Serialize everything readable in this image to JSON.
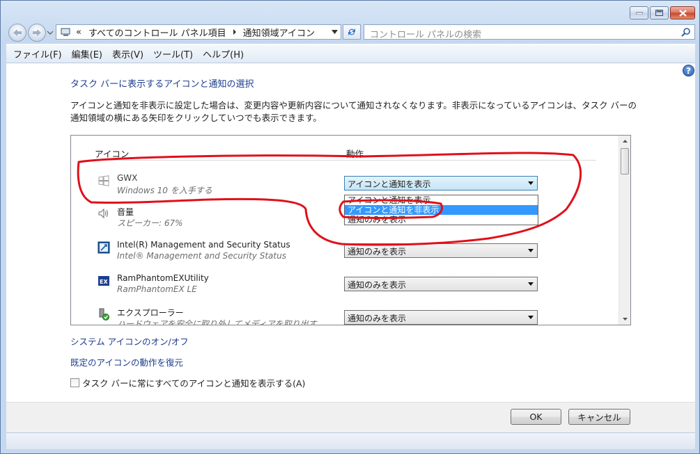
{
  "window": {
    "address_prefix": "«",
    "breadcrumb": [
      "すべてのコントロール パネル項目",
      "通知領域アイコン"
    ],
    "search_placeholder": "コントロール パネルの検索"
  },
  "menubar": {
    "items": [
      "ファイル(F)",
      "編集(E)",
      "表示(V)",
      "ツール(T)",
      "ヘルプ(H)"
    ]
  },
  "main": {
    "heading": "タスク バーに表示するアイコンと通知の選択",
    "description": "アイコンと通知を非表示に設定した場合は、変更内容や更新内容について通知されなくなります。非表示になっているアイコンは、タスク バーの通知領域の横にある矢印をクリックしていつでも表示できます。",
    "columns": {
      "icon": "アイコン",
      "behavior": "動作"
    },
    "rows": [
      {
        "name": "GWX",
        "sub": "Windows 10 を入手する",
        "behavior": "アイコンと通知を表示",
        "icon": "windows-logo-icon"
      },
      {
        "name": "音量",
        "sub": "スピーカー: 67%",
        "behavior": "アイコンと通知を表示",
        "icon": "speaker-icon"
      },
      {
        "name": "Intel(R) Management and Security Status",
        "sub": "Intel® Management and Security Status",
        "behavior": "通知のみを表示",
        "icon": "intel-security-icon"
      },
      {
        "name": "RamPhantomEXUtility",
        "sub": "RamPhantomEX LE",
        "behavior": "通知のみを表示",
        "icon": "ramphantom-icon"
      },
      {
        "name": "エクスプローラー",
        "sub": "ハードウェアを安全に取り外してメディアを取り出す",
        "behavior": "通知のみを表示",
        "icon": "safely-remove-icon"
      }
    ],
    "dropdown_options": [
      "アイコンと通知を表示",
      "アイコンと通知を非表示",
      "通知のみを表示"
    ],
    "dropdown_selected_index": 1
  },
  "links": {
    "system_icons": "システム アイコンのオン/オフ",
    "restore_defaults": "既定のアイコンの動作を復元"
  },
  "checkbox": {
    "always_show": "タスク バーに常にすべてのアイコンと通知を表示する(A)",
    "checked": false
  },
  "buttons": {
    "ok": "OK",
    "cancel": "キャンセル"
  },
  "colors": {
    "link": "#1e3d8f",
    "selection": "#3399ff",
    "annotation": "#e0101a"
  }
}
